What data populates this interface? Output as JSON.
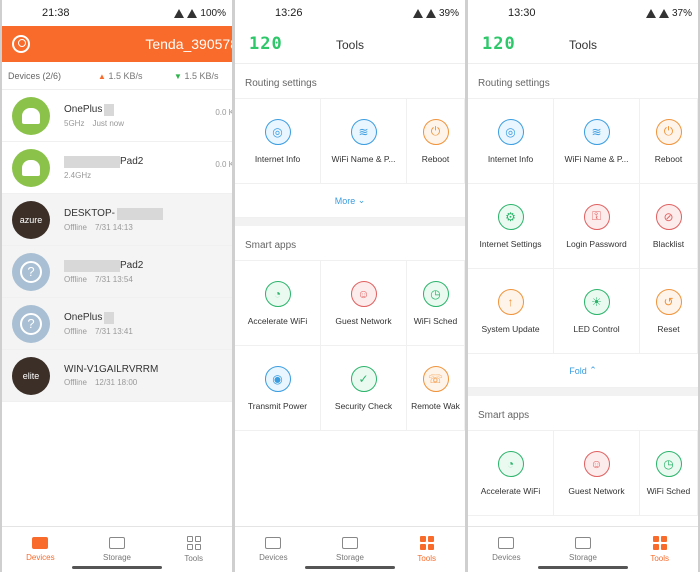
{
  "panel1": {
    "status": {
      "time": "21:38",
      "battery": "100%"
    },
    "header": {
      "title": "Tenda_390578"
    },
    "devices_bar": {
      "count_label": "Devices (2/6)",
      "upload": "1.5 KB/s",
      "download": "1.5 KB/s"
    },
    "devices": [
      {
        "avatar": "android",
        "name": "OnePlus",
        "band": "5GHz",
        "state": "Just now",
        "rate": "0.0 K"
      },
      {
        "avatar": "android",
        "name": "Pad2",
        "band": "2.4GHz",
        "state": "",
        "rate": "0.0 K"
      },
      {
        "avatar": "azure",
        "avatar_text": "azure",
        "name": "DESKTOP-",
        "band": "Offline",
        "state": "7/31 14:13",
        "rate": ""
      },
      {
        "avatar": "unknown",
        "name": "Pad2",
        "band": "Offline",
        "state": "7/31 13:54",
        "rate": ""
      },
      {
        "avatar": "unknown",
        "name": "OnePlus",
        "band": "Offline",
        "state": "7/31 13:41",
        "rate": ""
      },
      {
        "avatar": "azure",
        "avatar_text": "elite",
        "name": "WIN-V1GAILRVRRM",
        "band": "Offline",
        "state": "12/31 18:00",
        "rate": ""
      }
    ],
    "nav": {
      "devices": "Devices",
      "storage": "Storage",
      "tools": "Tools"
    }
  },
  "panel2": {
    "status": {
      "time": "13:26",
      "battery": "39%"
    },
    "logo": "120",
    "title": "Tools",
    "routing_label": "Routing settings",
    "routing_items": [
      "Internet Info",
      "WiFi Name & P...",
      "Reboot"
    ],
    "more_label": "More",
    "smart_label": "Smart apps",
    "smart_items": [
      "Accelerate WiFi",
      "Guest Network",
      "WiFi Sched",
      "Transmit Power",
      "Security Check",
      "Remote Wak"
    ],
    "nav": {
      "devices": "Devices",
      "storage": "Storage",
      "tools": "Tools"
    }
  },
  "panel3": {
    "status": {
      "time": "13:30",
      "battery": "37%"
    },
    "logo": "120",
    "title": "Tools",
    "routing_label": "Routing settings",
    "routing_items": [
      "Internet Info",
      "WiFi Name & P...",
      "Reboot",
      "Internet Settings",
      "Login Password",
      "Blacklist",
      "System Update",
      "LED Control",
      "Reset"
    ],
    "fold_label": "Fold",
    "smart_label": "Smart apps",
    "smart_items": [
      "Accelerate WiFi",
      "Guest Network",
      "WiFi Sched"
    ],
    "nav": {
      "devices": "Devices",
      "storage": "Storage",
      "tools": "Tools"
    }
  },
  "colors": {
    "accent": "#f96b2a",
    "logo_green": "#2ec76a",
    "link_blue": "#3a9de0"
  }
}
